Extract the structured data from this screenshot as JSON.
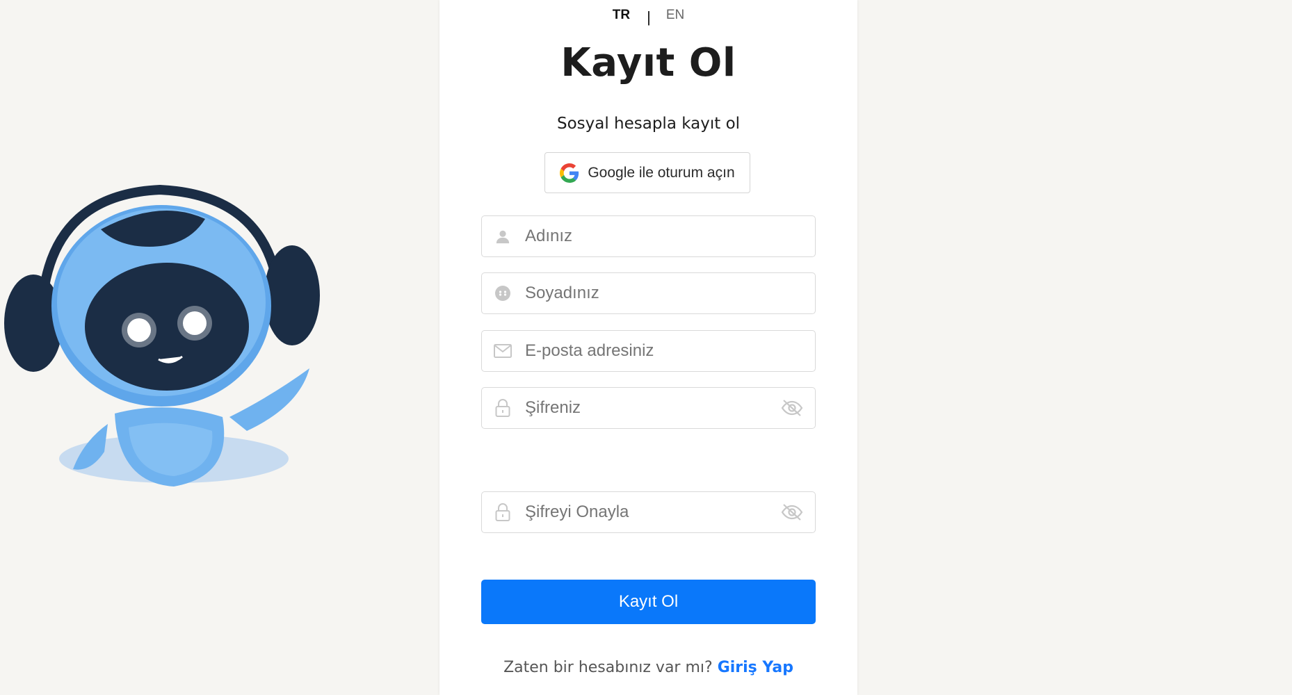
{
  "language": {
    "active": "TR",
    "separator": "|",
    "other": "EN"
  },
  "title": "Kayıt Ol",
  "subtitle": "Sosyal hesapla kayıt ol",
  "google": {
    "label": "Google ile oturum açın",
    "icon": "google-icon"
  },
  "fields": {
    "first_name": {
      "placeholder": "Adınız",
      "value": "",
      "icon": "user-icon"
    },
    "last_name": {
      "placeholder": "Soyadınız",
      "value": "",
      "icon": "smile-face-icon"
    },
    "email": {
      "placeholder": "E-posta adresiniz",
      "value": "",
      "icon": "mail-icon"
    },
    "password": {
      "placeholder": "Şifreniz",
      "value": "",
      "icon": "lock-icon",
      "toggle_icon": "eye-off-icon"
    },
    "confirm_password": {
      "placeholder": "Şifreyi Onayla",
      "value": "",
      "icon": "lock-icon",
      "toggle_icon": "eye-off-icon"
    }
  },
  "submit_label": "Kayıt Ol",
  "footer": {
    "text": "Zaten bir hesabınız var mı?",
    "link": "Giriş Yap"
  },
  "colors": {
    "primary": "#0a78fa",
    "link": "#1677ff",
    "background": "#f6f5f2",
    "mascot_blue": "#6fb2ef",
    "mascot_dark": "#1b2d45"
  }
}
